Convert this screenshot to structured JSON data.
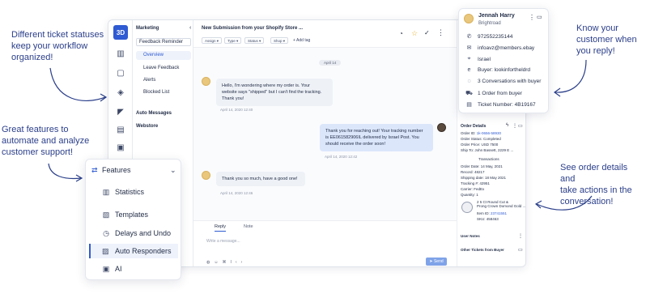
{
  "callouts": {
    "statuses": [
      "Different ticket statuses",
      "keep your workflow",
      "organized!"
    ],
    "automate": [
      "Great features to",
      "automate and analyze",
      "customer support!"
    ],
    "know": [
      "Know your",
      "customer when",
      "you reply!"
    ],
    "order": [
      "See order details and",
      "take actions in the",
      "conversation!"
    ]
  },
  "app": {
    "logo": "3D",
    "menu": {
      "section": "Marketing",
      "group": "Feedback Reminder",
      "items": [
        "Overview",
        "Leave Feedback",
        "Alerts",
        "Blocked List"
      ],
      "extra": [
        "Auto Messages",
        "Webstore"
      ]
    },
    "ticket_title": "New Submission from your Shopify Store ...",
    "chips": [
      "Assign",
      "Type",
      "Status",
      "Shop"
    ],
    "add_tag": "+ Add tag",
    "date_divider": "April 14",
    "messages": [
      {
        "text": [
          "Hello, I'm wondering where my order is. Your",
          "website says \"shipped\" but I can't find the tracking.",
          "Thank you!"
        ],
        "time": "April 14, 2020 12:40"
      },
      {
        "text": [
          "Thank you for reaching out! Your tracking number",
          "is EE061582906IL delivered by Israel Post. You",
          "should receive the order soon!"
        ],
        "time": "April 14, 2020 12:42"
      },
      {
        "text": [
          "Thank you so much, have a good one!"
        ],
        "time": "April 14, 2020 12:46"
      }
    ],
    "editor": {
      "tab_reply": "Reply",
      "tab_note": "Note",
      "placeholder": "Write a message...",
      "send": "Send"
    }
  },
  "order": {
    "title": "Order Details",
    "order_id_label": "Order ID:",
    "order_id": "1k-0656-58930",
    "status": "Order Status: Completed",
    "price": "Order Price: USD 7500",
    "ship_to": "Ship To: John Bassett, 2229 E ...",
    "transactions": "Transactions",
    "date": "Order Date: 14 May, 2021",
    "record": "Record: 48217",
    "shipping_date": "Shipping date: 18 May 2021",
    "tracking": "Tracking #: 42951",
    "carrier": "Carrier: FedEx",
    "quantity": "Quantity: 1",
    "item_name": [
      "2 5 Ct Round Cut &",
      "Prong Crown Domond Gold ..."
    ],
    "item_id_label": "Item ID:",
    "item_id": "23741551",
    "sku": "SKU: 458463",
    "user_notes": "User Notes",
    "other_tickets": "Other Tickets from Buyer"
  },
  "customer": {
    "name": "Jennah Harry",
    "company": "Brightroad",
    "phone": "972552235144",
    "email": "infoavz@members.ebay",
    "country": "Israel",
    "buyer": "Buyer: lookinfortheldrd",
    "conversations": "3 Conversations with buyer",
    "orders": "1 Order from buyer",
    "ticket": "Ticket Number: 4B19167"
  },
  "features": {
    "title": "Features",
    "items": [
      "Statistics",
      "Templates",
      "Delays and Undo",
      "Auto Responders",
      "AI"
    ]
  }
}
